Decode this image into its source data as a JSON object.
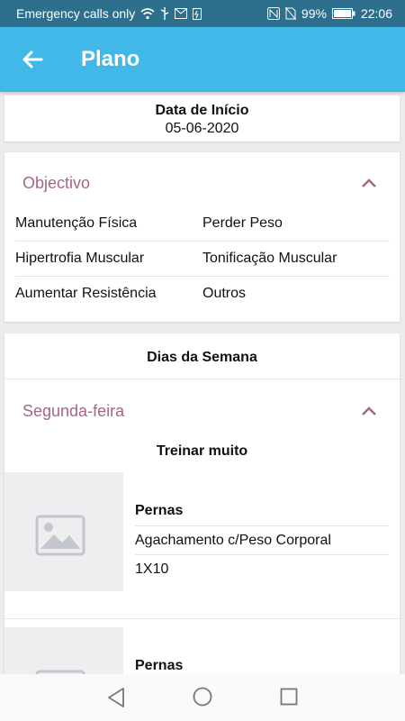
{
  "status": {
    "carrier": "Emergency calls only",
    "battery": "99%",
    "time": "22:06"
  },
  "header": {
    "title": "Plano"
  },
  "start": {
    "label": "Data de Início",
    "value": "05-06-2020"
  },
  "objective": {
    "title": "Objectivo",
    "items": [
      [
        "Manutenção Física",
        "Perder Peso"
      ],
      [
        "Hipertrofia Muscular",
        "Tonificação Muscular"
      ],
      [
        "Aumentar Resistência",
        "Outros"
      ]
    ]
  },
  "week": {
    "title": "Dias da Semana",
    "day": "Segunda-feira",
    "training": "Treinar muito",
    "exercises": [
      {
        "group": "Pernas",
        "name": "Agachamento c/Peso Corporal",
        "sets": "1X10"
      },
      {
        "group": "Pernas"
      }
    ]
  },
  "colors": {
    "appbar": "#41b8e8",
    "status": "#2e6f8e",
    "accent": "#a66587"
  }
}
